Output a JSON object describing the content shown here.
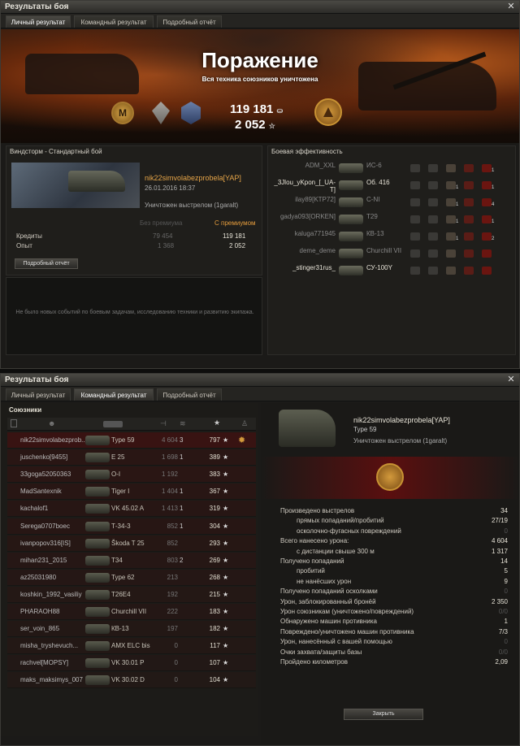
{
  "window1": {
    "title": "Результаты боя",
    "tabs": [
      "Личный результат",
      "Командный результат",
      "Подробный отчёт"
    ],
    "banner": {
      "title": "Поражение",
      "subtitle": "Вся техника союзников уничтожена",
      "badge_letter": "M"
    },
    "earnings": {
      "credits": "119 181",
      "exp": "2 052"
    },
    "battle": {
      "map": "Виндсторм - Стандартный бой",
      "player": "nik22simvolabezprobela[YAP]",
      "date": "26.01.2016 18:37",
      "killed_by": "Уничтожен выстрелом (1garalt)",
      "col_no_premium": "Без премиума",
      "col_premium": "С премиумом",
      "credits_label": "Кредиты",
      "credits_no_prem": "79 454",
      "credits_prem": "119 181",
      "exp_label": "Опыт",
      "exp_no_prem": "1 368",
      "exp_prem": "2 052",
      "details_button": "Подробный отчёт",
      "no_events": "Не было новых событий по боевым задачам, исследованию техники и развитию экипажа."
    },
    "efficiency": {
      "title": "Боевая эффективность",
      "rows": [
        {
          "player": "ADM_XXL",
          "tank": "ИС-6",
          "bright": false,
          "counts": [
            "",
            "1"
          ]
        },
        {
          "player": "_3Jlou_yKpon_[_UA-T]",
          "tank": "Об. 416",
          "bright": true,
          "counts": [
            "1",
            "1"
          ]
        },
        {
          "player": "ilay89[KTP72]",
          "tank": "C-NI",
          "bright": false,
          "counts": [
            "1",
            "4"
          ]
        },
        {
          "player": "gadya093[ORKEN]",
          "tank": "T29",
          "bright": false,
          "counts": [
            "1",
            "1"
          ]
        },
        {
          "player": "kaluga771945",
          "tank": "КВ-13",
          "bright": false,
          "counts": [
            "1",
            "2"
          ]
        },
        {
          "player": "deme_deme",
          "tank": "Churchill VII",
          "bright": false,
          "counts": [
            "",
            ""
          ]
        },
        {
          "player": "_stinger31rus_",
          "tank": "СУ-100Y",
          "bright": true,
          "counts": [
            "",
            ""
          ]
        }
      ]
    }
  },
  "window2": {
    "title": "Результаты боя",
    "tabs": [
      "Личный результат",
      "Командный результат",
      "Подробный отчёт"
    ],
    "allies_label": "Союзники",
    "team": [
      {
        "player": "nik22simvolabezprob...",
        "tank": "Type 59",
        "damage": "4 604",
        "kills": "3",
        "xp": "797",
        "highlight": true
      },
      {
        "player": "juschenko[9455]",
        "tank": "E 25",
        "damage": "1 698",
        "kills": "1",
        "xp": "389"
      },
      {
        "player": "33goga52050363",
        "tank": "O-I",
        "damage": "1 192",
        "kills": "",
        "xp": "383"
      },
      {
        "player": "MadSantexnik",
        "tank": "Tiger I",
        "damage": "1 404",
        "kills": "1",
        "xp": "367"
      },
      {
        "player": "kachalof1",
        "tank": "VK 45.02 A",
        "damage": "1 413",
        "kills": "1",
        "xp": "319"
      },
      {
        "player": "Serega0707boec",
        "tank": "Т-34-3",
        "damage": "852",
        "kills": "1",
        "xp": "304"
      },
      {
        "player": "ivanpopov316[IS]",
        "tank": "Škoda T 25",
        "damage": "852",
        "kills": "",
        "xp": "293"
      },
      {
        "player": "mihan231_2015",
        "tank": "T34",
        "damage": "803",
        "kills": "2",
        "xp": "269"
      },
      {
        "player": "az25031980",
        "tank": "Type 62",
        "damage": "213",
        "kills": "",
        "xp": "268"
      },
      {
        "player": "koshkin_1992_vasiliy",
        "tank": "T26E4",
        "damage": "192",
        "kills": "",
        "xp": "215"
      },
      {
        "player": "PHARAOH88",
        "tank": "Churchill VII",
        "damage": "222",
        "kills": "",
        "xp": "183"
      },
      {
        "player": "ser_voin_865",
        "tank": "КВ-13",
        "damage": "197",
        "kills": "",
        "xp": "182"
      },
      {
        "player": "misha_tryshevuch...",
        "tank": "AMX ELC bis",
        "damage": "0",
        "kills": "",
        "xp": "117"
      },
      {
        "player": "rachvel[MOPSY]",
        "tank": "VK 30.01 P",
        "damage": "0",
        "kills": "",
        "xp": "107"
      },
      {
        "player": "maks_maksimys_007",
        "tank": "VK 30.02 D",
        "damage": "0",
        "kills": "",
        "xp": "104"
      }
    ],
    "detail": {
      "player": "nik22simvolabezprobela[YAP]",
      "tank": "Type 59",
      "killed_by": "Уничтожен выстрелом (1garalt)",
      "stats": [
        {
          "label": "Произведено выстрелов",
          "value": "34",
          "indent": 0,
          "dim": false
        },
        {
          "label": "прямых попаданий/пробитий",
          "value": "27/19",
          "indent": 1,
          "dim": false
        },
        {
          "label": "осколочно-фугасных повреждений",
          "value": "0",
          "indent": 1,
          "dim": true
        },
        {
          "label": "Всего нанесено урона:",
          "value": "4 604",
          "indent": 0,
          "dim": false
        },
        {
          "label": "с дистанции свыше 300 м",
          "value": "1 317",
          "indent": 1,
          "dim": false
        },
        {
          "label": "Получено попаданий",
          "value": "14",
          "indent": 0,
          "dim": false
        },
        {
          "label": "пробитий",
          "value": "5",
          "indent": 1,
          "dim": false
        },
        {
          "label": "не нанёсших урон",
          "value": "9",
          "indent": 1,
          "dim": false
        },
        {
          "label": "Получено попаданий осколками",
          "value": "0",
          "indent": 0,
          "dim": true
        },
        {
          "label": "Урон, заблокированный бронёй",
          "value": "2 350",
          "indent": 0,
          "dim": false
        },
        {
          "label": "Урон союзникам (уничтожено/повреждений)",
          "value": "0/0",
          "indent": 0,
          "dim": true
        },
        {
          "label": "Обнаружено машин противника",
          "value": "1",
          "indent": 0,
          "dim": false
        },
        {
          "label": "Повреждено/уничтожено машин противника",
          "value": "7/3",
          "indent": 0,
          "dim": false
        },
        {
          "label": "Урон, нанесённый с вашей помощью",
          "value": "0",
          "indent": 0,
          "dim": true
        },
        {
          "label": "Очки захвата/защиты базы",
          "value": "0/0",
          "indent": 0,
          "dim": true
        },
        {
          "label": "Пройдено километров",
          "value": "2,09",
          "indent": 0,
          "dim": false
        }
      ],
      "close_button": "Закрыть"
    }
  },
  "colors": {
    "accent_orange": "#e39b3c",
    "highlight_red": "#4a0d0d"
  }
}
